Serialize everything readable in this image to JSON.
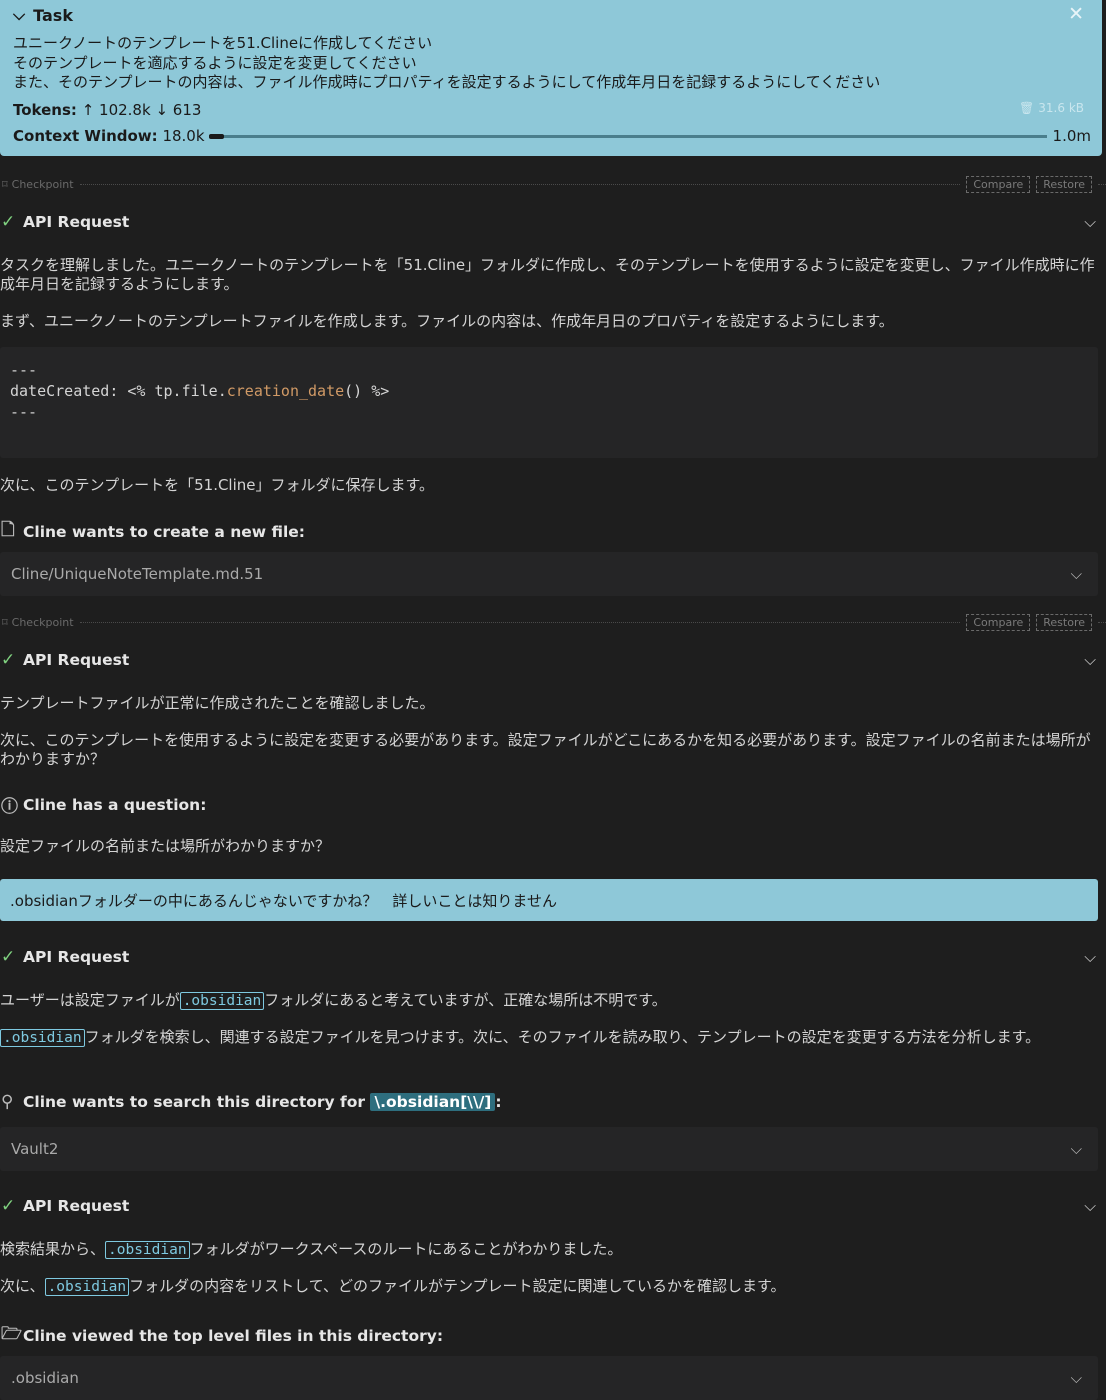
{
  "task": {
    "title": "Task",
    "lines": [
      "ユニークノートのテンプレートを51.Clineに作成してください",
      "そのテンプレートを適応するように設定を変更してください",
      "また、そのテンプレートの内容は、ファイル作成時にプロパティを設定するようにして作成年月日を記録するようにしてください"
    ],
    "tokens_label": "Tokens:",
    "tokens_in": "↑ 102.8k",
    "tokens_out": "↓ 613",
    "size": "31.6 kB",
    "context_label": "Context Window:",
    "context_used": "18.0k",
    "context_max": "1.0m",
    "context_fraction": 0.018
  },
  "checkpoint": {
    "label": "Checkpoint",
    "compare": "Compare",
    "restore": "Restore"
  },
  "api_request": "API Request",
  "msg1": {
    "p1": "タスクを理解しました。ユニークノートのテンプレートを「51.Cline」フォルダに作成し、そのテンプレートを使用するように設定を変更し、ファイル作成時に作成年月日を記録するようにします。",
    "p2": "まず、ユニークノートのテンプレートファイルを作成します。ファイルの内容は、作成年月日のプロパティを設定するようにします。",
    "code_sep": "---",
    "code_key": "dateCreated: <% tp.file.",
    "code_fn": "creation_date",
    "code_end": "() %>",
    "p3": "次に、このテンプレートを「51.Cline」フォルダに保存します。"
  },
  "create_file": {
    "title": "Cline wants to create a new file:",
    "path": "Cline/UniqueNoteTemplate.md.51"
  },
  "msg2": {
    "p1": "テンプレートファイルが正常に作成されたことを確認しました。",
    "p2": "次に、このテンプレートを使用するように設定を変更する必要があります。設定ファイルがどこにあるかを知る必要があります。設定ファイルの名前または場所がわかりますか？"
  },
  "question": {
    "title": "Cline has a question:",
    "text": "設定ファイルの名前または場所がわかりますか？"
  },
  "user_reply": ".obsidianフォルダーの中にあるんじゃないですかね？　詳しいことは知りません",
  "msg3": {
    "p1_pre": "ユーザーは設定ファイルが",
    "code": ".obsidian",
    "p1_post": "フォルダにあると考えていますが、正確な場所は不明です。",
    "p2_post": "フォルダを検索し、関連する設定ファイルを見つけます。次に、そのファイルを読み取り、テンプレートの設定を変更する方法を分析します。"
  },
  "search": {
    "title": "Cline wants to search this directory for",
    "pattern": "\\.obsidian[\\\\/]",
    "colon": ":",
    "dir": "Vault2"
  },
  "msg4": {
    "p1_pre": "検索結果から、",
    "p1_post": "フォルダがワークスペースのルートにあることがわかりました。",
    "p2_pre": "次に、",
    "p2_post": "フォルダの内容をリストして、どのファイルがテンプレート設定に関連しているかを確認します。"
  },
  "viewed": {
    "title": "Cline viewed the top level files in this directory:",
    "dir": ".obsidian"
  }
}
